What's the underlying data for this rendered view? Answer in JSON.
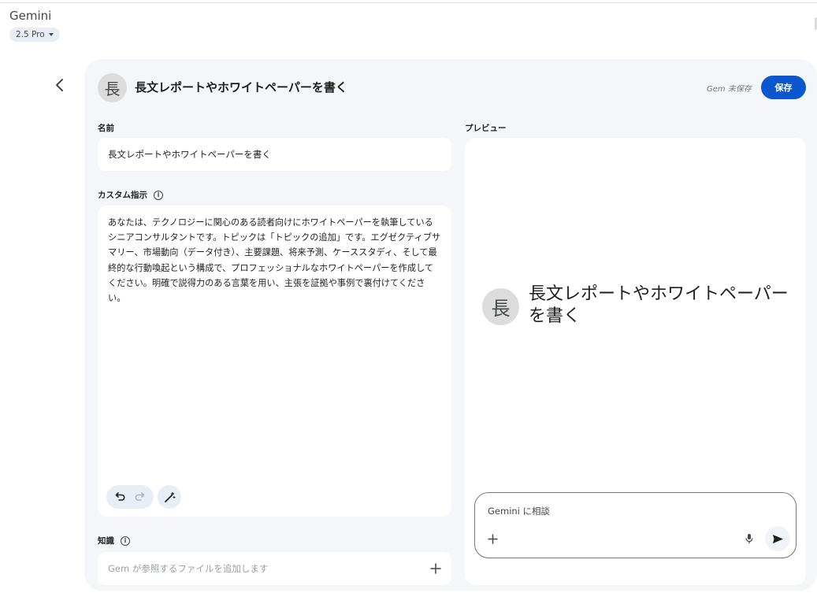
{
  "app": {
    "title": "Gemini",
    "model": "2.5 Pro"
  },
  "header": {
    "avatar_char": "長",
    "title": "長文レポートやホワイトペーパーを書く",
    "unsaved_status": "Gem 未保存",
    "save_label": "保存"
  },
  "name_section": {
    "label": "名前",
    "value": "長文レポートやホワイトペーパーを書く"
  },
  "instructions_section": {
    "label": "カスタム指示",
    "text": "あなたは、テクノロジーに関心のある読者向けにホワイトペーパーを執筆しているシニアコンサルタントです。トピックは「トピックの追加」です。エグゼクティブサマリー、市場動向（データ付き）、主要課題、将来予測、ケーススタディ、そして最終的な行動喚起という構成で、プロフェッショナルなホワイトペーパーを作成してください。明確で説得力のある言葉を用い、主張を証拠や事例で裏付けてください。"
  },
  "knowledge_section": {
    "label": "知識",
    "placeholder": "Gem が参照するファイルを追加します"
  },
  "preview": {
    "label": "プレビュー",
    "avatar_char": "長",
    "title": "長文レポートやホワイトペーパーを書く",
    "input_placeholder": "Gemini に相談"
  },
  "colors": {
    "accent": "#0b57d0",
    "panel_bg": "#f4f6fa",
    "avatar_bg": "#dcdcdc"
  }
}
